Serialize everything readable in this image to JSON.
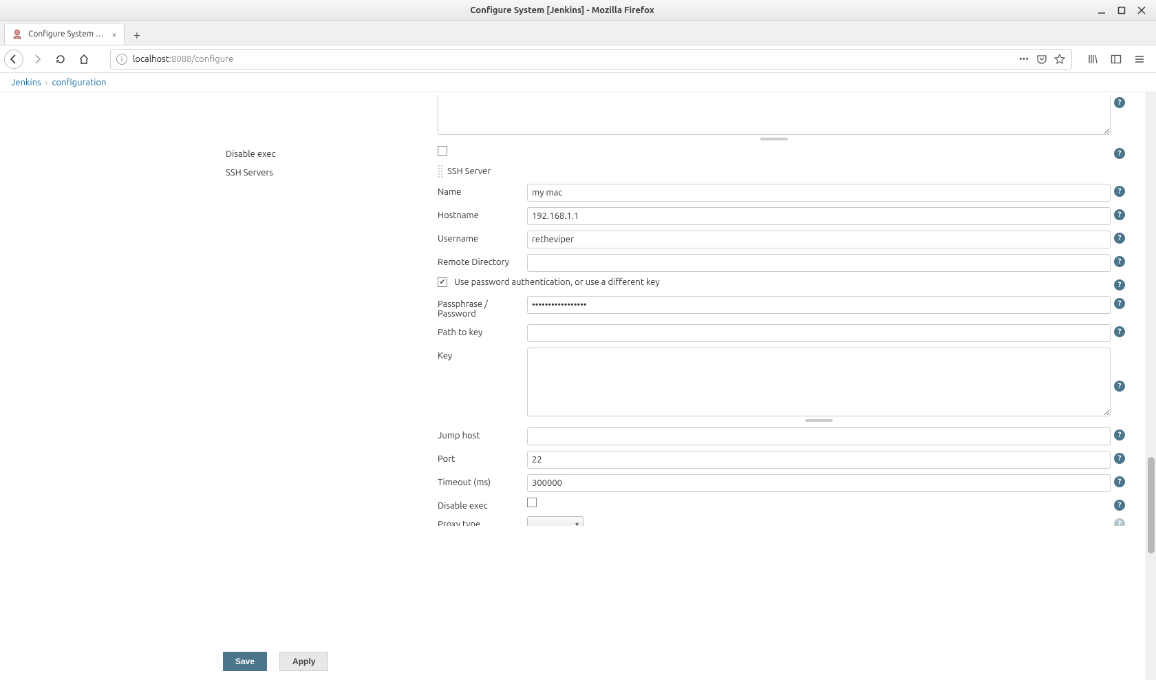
{
  "window": {
    "title": "Configure System [Jenkins] - Mozilla Firefox"
  },
  "tab": {
    "title": "Configure System [Jenkins]"
  },
  "url": {
    "host": "localhost",
    "port_path": ":8088/configure"
  },
  "breadcrumbs": {
    "jenkins": "Jenkins",
    "configuration": "configuration"
  },
  "labels": {
    "disable_exec_outer": "Disable exec",
    "ssh_servers": "SSH Servers",
    "ssh_server_heading": "SSH Server",
    "name": "Name",
    "hostname": "Hostname",
    "username": "Username",
    "remote_directory": "Remote Directory",
    "use_password_auth": "Use password authentication, or use a different key",
    "passphrase": "Passphrase / Password",
    "path_to_key": "Path to key",
    "key": "Key",
    "jump_host": "Jump host",
    "port": "Port",
    "timeout": "Timeout (ms)",
    "disable_exec_inner": "Disable exec",
    "proxy_type": "Proxy type"
  },
  "values": {
    "name": "my mac",
    "hostname": "192.168.1.1",
    "username": "retheviper",
    "remote_directory": "",
    "passphrase": "•••••••••••••••••",
    "path_to_key": "",
    "key": "",
    "jump_host": "",
    "port": "22",
    "timeout": "300000"
  },
  "checkbox": {
    "disable_exec_outer": false,
    "use_password_auth": true,
    "disable_exec_inner": false
  },
  "buttons": {
    "save": "Save",
    "apply": "Apply"
  }
}
